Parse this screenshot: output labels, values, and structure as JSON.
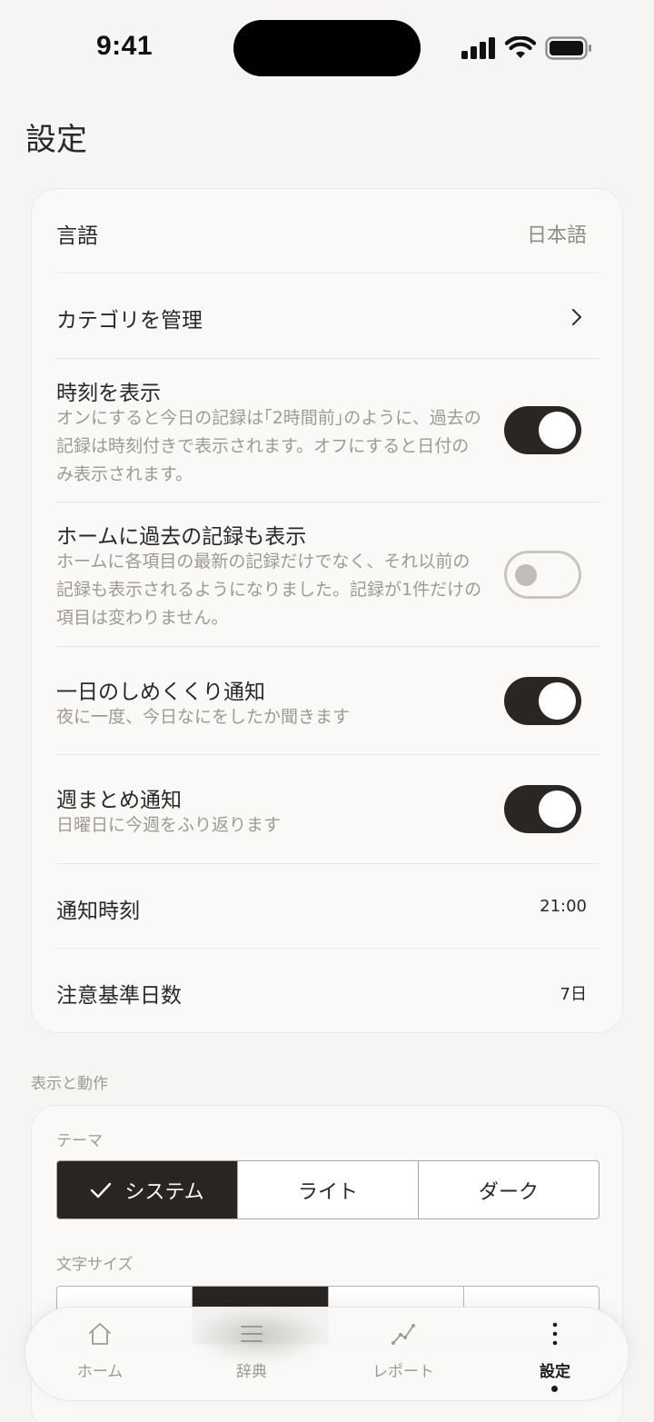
{
  "status_bar": {
    "time": "9:41"
  },
  "page_title": "設定",
  "settings": {
    "language": {
      "label": "言語",
      "value": "日本語"
    },
    "categories": {
      "label": "カテゴリを管理"
    },
    "show_time": {
      "label": "時刻を表示",
      "description": "オンにすると今日の記録は｢2時間前｣のように、過去の記録は時刻付きで表示されます。オフにすると日付のみ表示されます。",
      "enabled": true
    },
    "show_past": {
      "label": "ホームに過去の記録も表示",
      "description": "ホームに各項目の最新の記録だけでなく、それ以前の記録も表示されるようになりました。記録が1件だけの項目は変わりません。",
      "enabled": false
    },
    "daily_notify": {
      "label": "一日のしめくくり通知",
      "description": "夜に一度、今日なにをしたか聞きます",
      "enabled": true
    },
    "weekly_notify": {
      "label": "週まとめ通知",
      "description": "日曜日に今週をふり返ります",
      "enabled": true
    },
    "notify_time": {
      "label": "通知時刻",
      "value": "21:00"
    },
    "alert_days": {
      "label": "注意基準日数",
      "value": "7日"
    }
  },
  "display_section": {
    "title": "表示と動作",
    "theme": {
      "label": "テーマ",
      "options": [
        "システム",
        "ライト",
        "ダーク"
      ],
      "selected": "システム"
    },
    "text_size": {
      "label": "文字サイズ"
    }
  },
  "tab_bar": {
    "tabs": [
      {
        "label": "ホーム",
        "icon": "home-icon"
      },
      {
        "label": "辞典",
        "icon": "list-icon"
      },
      {
        "label": "レポート",
        "icon": "chart-line-icon"
      },
      {
        "label": "設定",
        "icon": "more-vertical-icon",
        "active": true
      }
    ]
  }
}
